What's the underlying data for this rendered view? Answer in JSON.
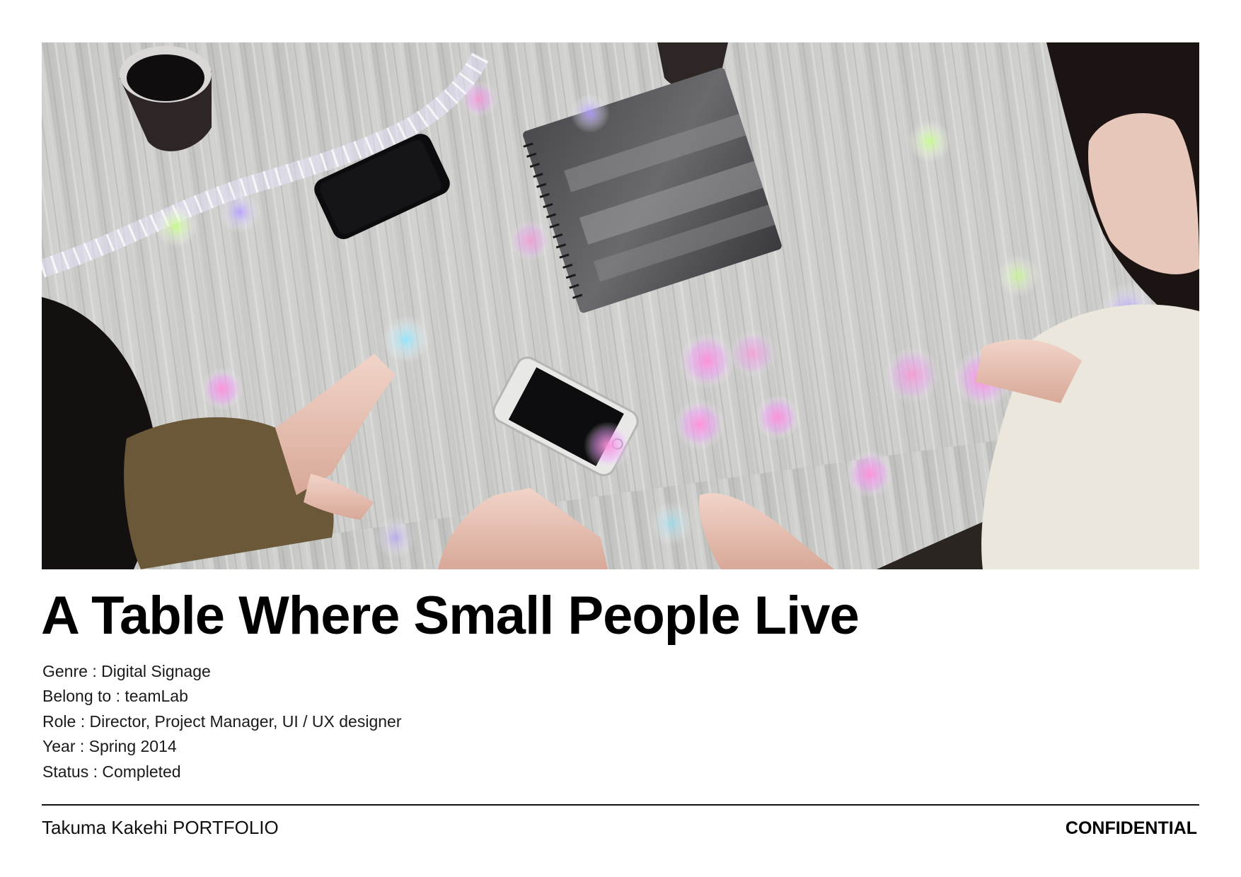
{
  "title": "A Table Where Small People Live",
  "details": [
    "Genre : Digital Signage",
    "Belong to : teamLab",
    "Role : Director, Project Manager, UI / UX designer",
    "Year : Spring 2014",
    "Status : Completed"
  ],
  "footer": {
    "left": "Takuma Kakehi PORTFOLIO",
    "right": "CONFIDENTIAL"
  }
}
